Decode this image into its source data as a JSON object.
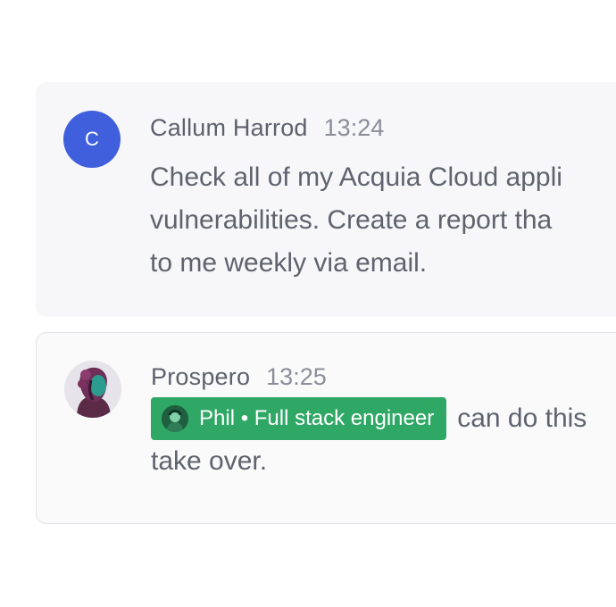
{
  "messages": [
    {
      "author": "Callum Harrod",
      "time": "13:24",
      "avatar_initial": "C",
      "avatar_color": "#3f5fdc",
      "lines": [
        "Check all of my Acquia Cloud appli",
        "vulnerabilities. Create a report tha",
        "to me weekly via email."
      ]
    },
    {
      "author": "Prospero",
      "time": "13:25",
      "avatar_icon": "woman-portrait-avatar",
      "mention": "Phil • Full stack engineer",
      "mention_icon": "phil-avatar-icon",
      "mention_color": "#2fa866",
      "line1_after_mention": "can do this",
      "line2": "take over."
    }
  ]
}
